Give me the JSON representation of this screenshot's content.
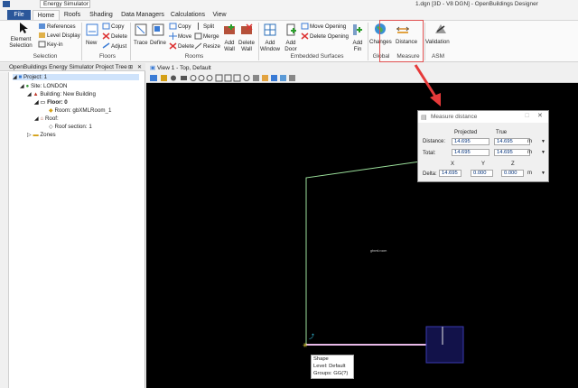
{
  "titlebar": {
    "app_name": "Energy Simulator",
    "title": "1.dgn [3D - V8 DGN] - OpenBuildings Designer"
  },
  "tabs": [
    "File",
    "Home",
    "Roofs",
    "Shading",
    "Data Managers",
    "Calculations",
    "View"
  ],
  "ribbon": {
    "selection": {
      "group": "Selection",
      "element_selection": "Element Selection",
      "references": "References",
      "level_display": "Level Display",
      "key_in": "Key-in"
    },
    "floors": {
      "group": "Floors",
      "new": "New",
      "copy": "Copy",
      "delete": "Delete",
      "adjust": "Adjust"
    },
    "rooms": {
      "group": "Rooms",
      "trace": "Trace",
      "define": "Define",
      "copy": "Copy",
      "move": "Move",
      "delete": "Delete",
      "split": "Split",
      "merge": "Merge",
      "resize": "Resize",
      "add_wall": "Add Wall",
      "delete_wall": "Delete Wall"
    },
    "embedded": {
      "group": "Embedded Surfaces",
      "add_window": "Add Window",
      "add_door": "Add Door",
      "move_opening": "Move Opening",
      "delete_opening": "Delete Opening",
      "add_fin": "Add Fin"
    },
    "global": {
      "group": "Global",
      "changes": "Changes"
    },
    "measure": {
      "group": "Measure",
      "distance": "Distance"
    },
    "ashrae": {
      "group": "ASM",
      "validation": "Validation"
    }
  },
  "project_tree": {
    "title": "OpenBuildings Energy Simulator Project Tree",
    "items": [
      "Project: 1",
      "Site: LONDON",
      "Building: New Building",
      "Floor: 0",
      "Room: gbXMLRoom_1",
      "Roof:",
      "Roof section: 1",
      "Zones"
    ]
  },
  "view": {
    "title": "View 1 - Top, Default",
    "center_label": "gbxml.room"
  },
  "measure_dialog": {
    "title": "Measure distance",
    "col_projected": "Projected",
    "col_true": "True",
    "distance_label": "Distance:",
    "distance_projected": "14.695",
    "distance_true": "14.695",
    "distance_unit": "m",
    "total_label": "Total:",
    "total_projected": "14.695",
    "total_true": "14.695",
    "total_unit": "m",
    "col_x": "X",
    "col_y": "Y",
    "col_z": "Z",
    "delta_label": "Delta:",
    "delta_x": "14.695",
    "delta_y": "0.000",
    "delta_z": "0.000",
    "delta_unit": "m"
  },
  "tooltip": {
    "line1": "Shape",
    "line2": "Level: Default",
    "line3": "Groups: GG(?)"
  }
}
